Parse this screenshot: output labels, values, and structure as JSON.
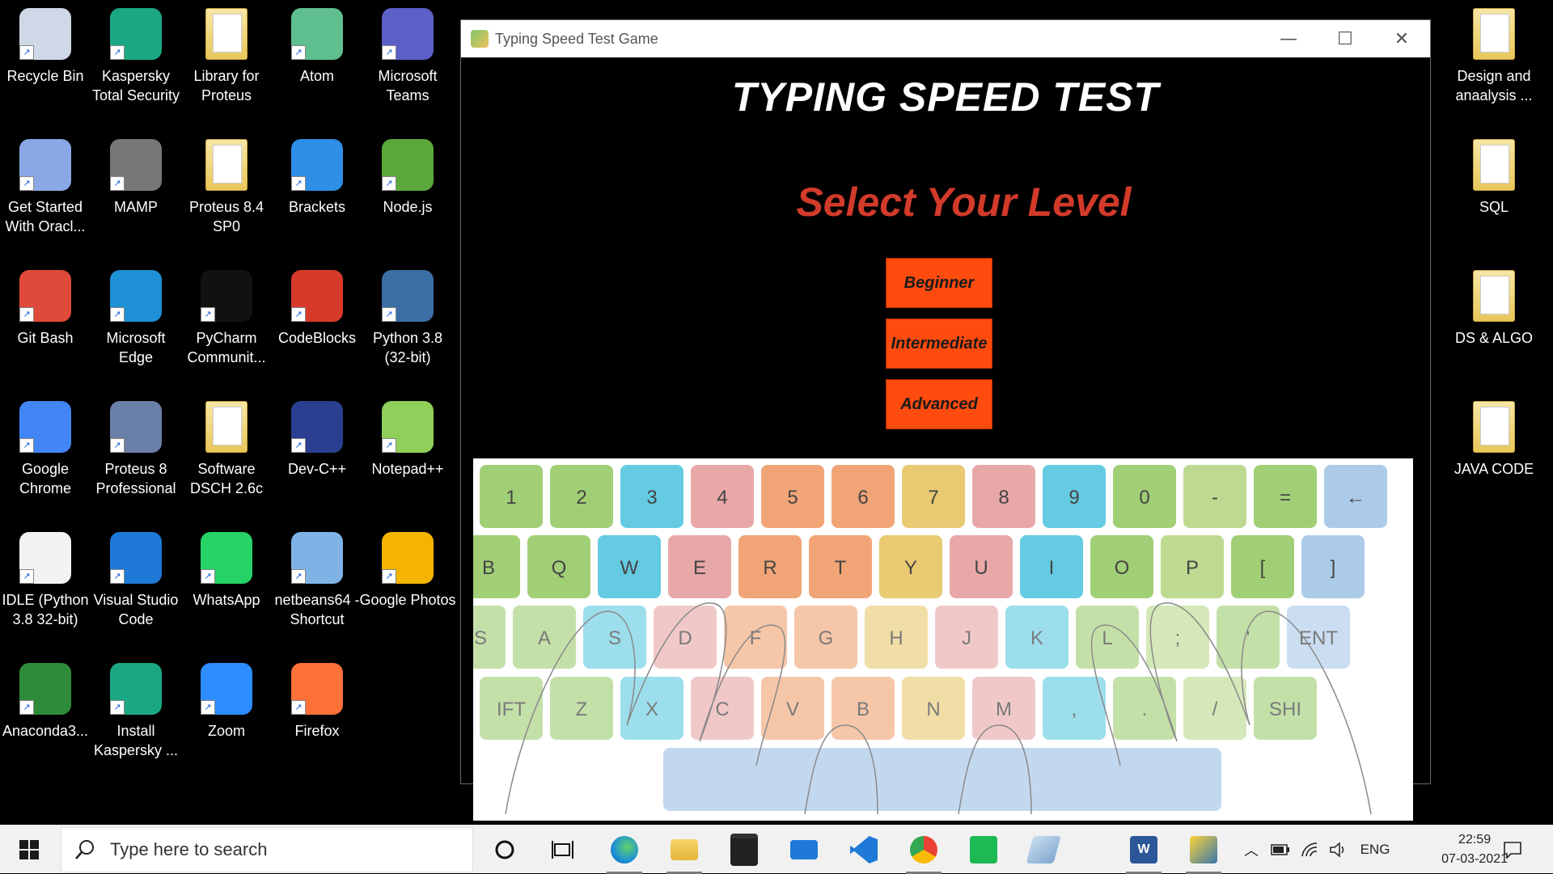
{
  "desktop": {
    "icons": [
      {
        "label": "Recycle Bin",
        "icon": "recycle-bin-icon",
        "color": "#cfd8e6"
      },
      {
        "label": "Kaspersky Total Security",
        "icon": "kaspersky-icon",
        "color": "#1ba784"
      },
      {
        "label": "Library for Proteus",
        "icon": "folder-icon",
        "color": "#e8c75a"
      },
      {
        "label": "Atom",
        "icon": "atom-icon",
        "color": "#5fbf8f"
      },
      {
        "label": "Microsoft Teams",
        "icon": "teams-icon",
        "color": "#5b5fc7"
      },
      {
        "label": "Get Started With Oracl...",
        "icon": "oracle-xe-icon",
        "color": "#8aa8e6"
      },
      {
        "label": "MAMP",
        "icon": "mamp-icon",
        "color": "#777777"
      },
      {
        "label": "Proteus 8.4 SP0",
        "icon": "folder-icon",
        "color": "#e8c75a"
      },
      {
        "label": "Brackets",
        "icon": "brackets-icon",
        "color": "#2f8ee6"
      },
      {
        "label": "Node.js",
        "icon": "nodejs-icon",
        "color": "#5aa83a"
      },
      {
        "label": "Git Bash",
        "icon": "git-bash-icon",
        "color": "#e04a3a"
      },
      {
        "label": "Microsoft Edge",
        "icon": "edge-icon",
        "color": "#1e90d6"
      },
      {
        "label": "PyCharm Communit...",
        "icon": "pycharm-icon",
        "color": "#111111"
      },
      {
        "label": "CodeBlocks",
        "icon": "codeblocks-icon",
        "color": "#d83a2a"
      },
      {
        "label": "Python 3.8 (32-bit)",
        "icon": "python-icon",
        "color": "#3a6ea5"
      },
      {
        "label": "Google Chrome",
        "icon": "chrome-icon",
        "color": "#4285f4"
      },
      {
        "label": "Proteus 8 Professional",
        "icon": "proteus-icon",
        "color": "#6a7fa8"
      },
      {
        "label": "Software DSCH 2.6c",
        "icon": "folder-icon",
        "color": "#e8c75a"
      },
      {
        "label": "Dev-C++",
        "icon": "devcpp-icon",
        "color": "#2a3f8f"
      },
      {
        "label": "Notepad++",
        "icon": "notepadpp-icon",
        "color": "#8fcf5a"
      },
      {
        "label": "IDLE (Python 3.8 32-bit)",
        "icon": "idle-icon",
        "color": "#f2f2f2"
      },
      {
        "label": "Visual Studio Code",
        "icon": "vscode-icon",
        "color": "#1e7ad6"
      },
      {
        "label": "WhatsApp",
        "icon": "whatsapp-icon",
        "color": "#25d366"
      },
      {
        "label": "netbeans64 - Shortcut",
        "icon": "netbeans-icon",
        "color": "#7fb3e6"
      },
      {
        "label": "Google Photos",
        "icon": "google-photos-icon",
        "color": "#f4b400"
      },
      {
        "label": "Anaconda3...",
        "icon": "anaconda-icon",
        "color": "#2e8b3a"
      },
      {
        "label": "Install Kaspersky ...",
        "icon": "kaspersky-install-icon",
        "color": "#1ba784"
      },
      {
        "label": "Zoom",
        "icon": "zoom-icon",
        "color": "#2d8cff"
      },
      {
        "label": "Firefox",
        "icon": "firefox-icon",
        "color": "#ff7139"
      },
      {
        "label": "Design and anaalysis ...",
        "icon": "folder-icon",
        "color": "#e8c75a"
      },
      {
        "label": "SQL",
        "icon": "folder-icon",
        "color": "#e8c75a"
      },
      {
        "label": "DS & ALGO",
        "icon": "folder-icon",
        "color": "#e8c75a"
      },
      {
        "label": "JAVA CODE",
        "icon": "folder-icon",
        "color": "#e8c75a"
      }
    ]
  },
  "window": {
    "title": "Typing Speed Test Game",
    "minimize": "—",
    "maximize": "☐",
    "close": "✕"
  },
  "game": {
    "title": "TYPING SPEED TEST",
    "prompt": "Select Your Level",
    "levels": [
      "Beginner",
      "Intermediate",
      "Advanced"
    ],
    "accent": "#ff4b0e",
    "prompt_color": "#d23a2a"
  },
  "keyboard": {
    "rows": [
      [
        "1",
        "2",
        "3",
        "4",
        "5",
        "6",
        "7",
        "8",
        "9",
        "0",
        "-",
        "=",
        "←"
      ],
      [
        "B",
        "Q",
        "W",
        "E",
        "R",
        "T",
        "Y",
        "U",
        "I",
        "O",
        "P",
        "[",
        "]"
      ],
      [
        "PS",
        "A",
        "S",
        "D",
        "F",
        "G",
        "H",
        "J",
        "K",
        "L",
        ";",
        "'",
        "ENT"
      ],
      [
        "IFT",
        "Z",
        "X",
        "C",
        "V",
        "B",
        "N",
        "M",
        ",",
        ".",
        "/",
        "SHI"
      ]
    ]
  },
  "taskbar": {
    "search_placeholder": "Type here to search",
    "language": "ENG",
    "time": "22:59",
    "date": "07-03-2021"
  }
}
